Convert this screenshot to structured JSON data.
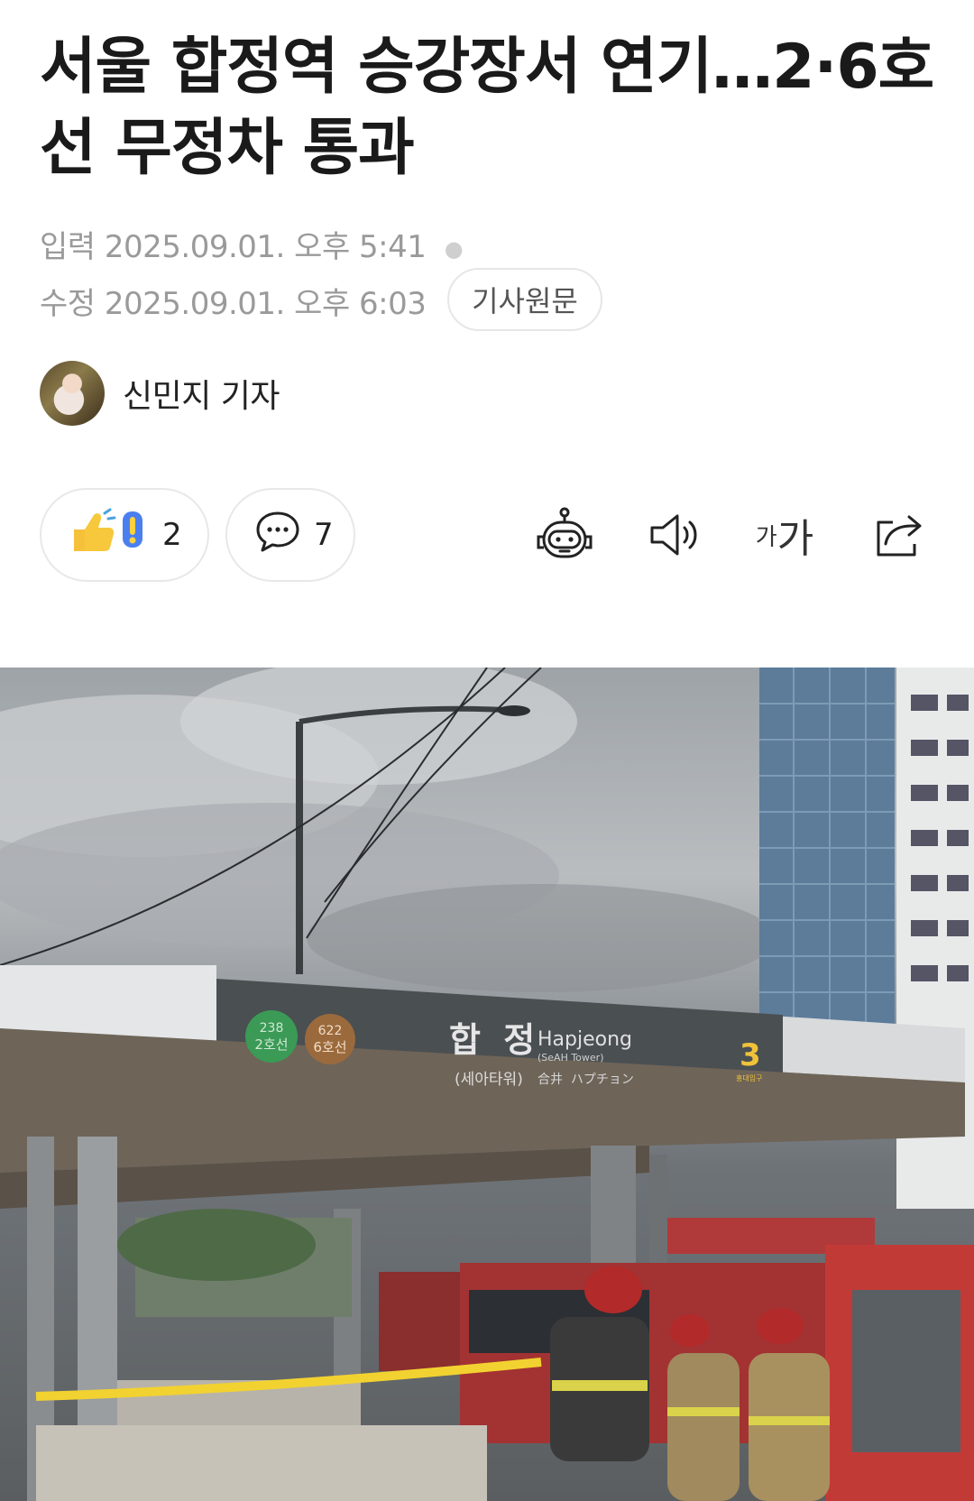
{
  "article": {
    "headline": "서울 합정역 승강장서 연기…2·6호선 무정차 통과",
    "input_label": "입력",
    "input_time": "2025.09.01. 오후 5:41",
    "modified_label": "수정",
    "modified_time": "2025.09.01. 오후 6:03",
    "original_button": "기사원문",
    "reporter": "신민지 기자"
  },
  "actions": {
    "reaction_count": "2",
    "comment_count": "7",
    "font_small": "가",
    "font_big": "가"
  },
  "photo": {
    "station_name": "합 정",
    "station_roman": "Hapjeong",
    "station_sub": "(SeAH Tower)",
    "station_korean_sub": "(세아타워)",
    "station_cjk": "合井  ハプチョン",
    "line2_num": "238",
    "line2_label": "2호선",
    "line6_num": "622",
    "line6_label": "6호선",
    "exit_num": "3",
    "exit_sub": "홍대입구"
  }
}
